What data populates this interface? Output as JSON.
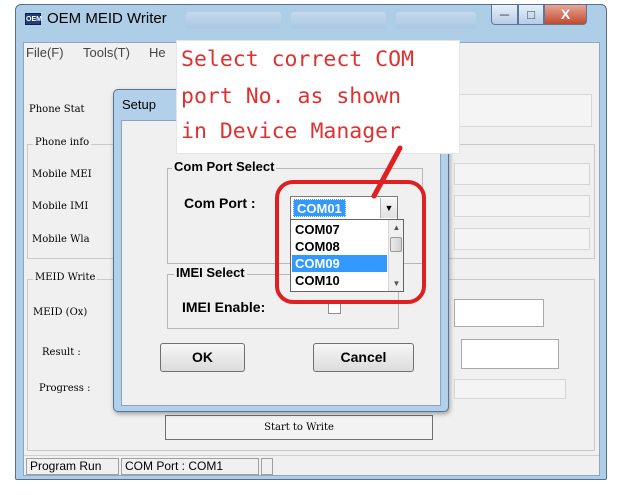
{
  "window": {
    "title": "OEM MEID Writer",
    "app_icon_text": "OEM",
    "controls": {
      "minimize": "─",
      "maximize": "□",
      "close": "X"
    }
  },
  "menu": [
    {
      "label": "File(F)"
    },
    {
      "label": "Tools(T)"
    },
    {
      "label": "He"
    }
  ],
  "main": {
    "phone_status_label": "Phone Stat",
    "phone_info": {
      "group_title": "Phone info",
      "labels": [
        "Mobile MEI",
        "Mobile IMI",
        "Mobile Wla"
      ]
    },
    "meid_write": {
      "group_title": "MEID Write",
      "meid_label": "MEID (Ox)",
      "result_label": "Result :",
      "progress_label": "Progress :",
      "start_button": "Start to Write"
    }
  },
  "status_bar": {
    "program": "Program Run",
    "com_port": "COM Port : COM1"
  },
  "dialog": {
    "title": "Setup",
    "close": "x",
    "com_group_title": "Com Port Select",
    "com_port_label": "Com Port :",
    "com_port_value": "COM01",
    "dropdown_options": [
      "COM07",
      "COM08",
      "COM09",
      "COM10"
    ],
    "selected_option": "COM09",
    "imei_group_title": "IMEI Select",
    "imei_enable_label": "IMEI Enable:",
    "imei_enable_checked": false,
    "ok_button": "OK",
    "cancel_button": "Cancel"
  },
  "annotation": {
    "lines": [
      "Select correct COM",
      "port No. as shown",
      "in Device Manager"
    ],
    "color": "#e03131"
  },
  "colors": {
    "window_frame": "#aecde6",
    "selection": "#3399ff",
    "close_button": "#c24a30"
  }
}
